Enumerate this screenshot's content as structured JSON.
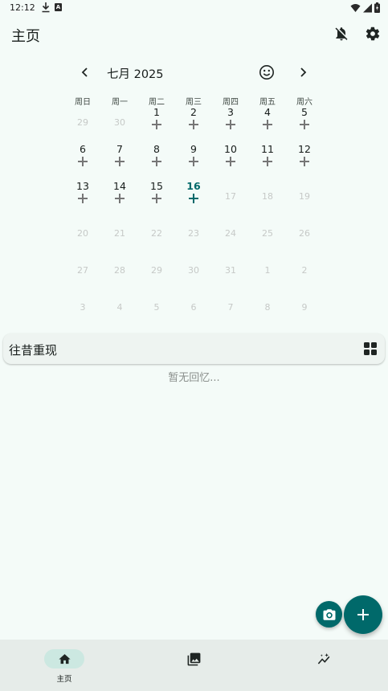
{
  "status_bar": {
    "time": "12:12",
    "notification_icons": [
      "download-icon",
      "a-badge-icon"
    ],
    "system_icons": [
      "wifi-icon",
      "signal-icon",
      "battery-icon"
    ]
  },
  "app_bar": {
    "title": "主页",
    "icons": [
      "notifications-off-icon",
      "settings-icon"
    ]
  },
  "calendar": {
    "month_label": "七月 2025",
    "weekdays": [
      "周日",
      "周一",
      "周二",
      "周三",
      "周四",
      "周五",
      "周六"
    ],
    "weeks": [
      [
        {
          "d": "29",
          "s": "faded"
        },
        {
          "d": "30",
          "s": "faded"
        },
        {
          "d": "1",
          "s": "add"
        },
        {
          "d": "2",
          "s": "add"
        },
        {
          "d": "3",
          "s": "add"
        },
        {
          "d": "4",
          "s": "add"
        },
        {
          "d": "5",
          "s": "add"
        }
      ],
      [
        {
          "d": "6",
          "s": "add"
        },
        {
          "d": "7",
          "s": "add"
        },
        {
          "d": "8",
          "s": "add"
        },
        {
          "d": "9",
          "s": "add"
        },
        {
          "d": "10",
          "s": "add"
        },
        {
          "d": "11",
          "s": "add"
        },
        {
          "d": "12",
          "s": "add"
        }
      ],
      [
        {
          "d": "13",
          "s": "add"
        },
        {
          "d": "14",
          "s": "add"
        },
        {
          "d": "15",
          "s": "add"
        },
        {
          "d": "16",
          "s": "today"
        },
        {
          "d": "17",
          "s": "faded"
        },
        {
          "d": "18",
          "s": "faded"
        },
        {
          "d": "19",
          "s": "faded"
        }
      ],
      [
        {
          "d": "20",
          "s": "faded"
        },
        {
          "d": "21",
          "s": "faded"
        },
        {
          "d": "22",
          "s": "faded"
        },
        {
          "d": "23",
          "s": "faded"
        },
        {
          "d": "24",
          "s": "faded"
        },
        {
          "d": "25",
          "s": "faded"
        },
        {
          "d": "26",
          "s": "faded"
        }
      ],
      [
        {
          "d": "27",
          "s": "faded"
        },
        {
          "d": "28",
          "s": "faded"
        },
        {
          "d": "29",
          "s": "faded"
        },
        {
          "d": "30",
          "s": "faded"
        },
        {
          "d": "31",
          "s": "faded"
        },
        {
          "d": "1",
          "s": "faded"
        },
        {
          "d": "2",
          "s": "faded"
        }
      ],
      [
        {
          "d": "3",
          "s": "faded"
        },
        {
          "d": "4",
          "s": "faded"
        },
        {
          "d": "5",
          "s": "faded"
        },
        {
          "d": "6",
          "s": "faded"
        },
        {
          "d": "7",
          "s": "faded"
        },
        {
          "d": "8",
          "s": "faded"
        },
        {
          "d": "9",
          "s": "faded"
        }
      ]
    ]
  },
  "memories": {
    "title": "往昔重现",
    "empty_text": "暂无回忆..."
  },
  "bottom_nav": {
    "items": [
      {
        "label": "主页",
        "icon": "home-icon",
        "active": true
      },
      {
        "label": "",
        "icon": "photo-library-icon"
      },
      {
        "label": "",
        "icon": "insights-icon"
      }
    ]
  },
  "colors": {
    "accent": "#00696a",
    "background": "#f4fbf8",
    "nav_background": "#e6ece9",
    "active_pill": "#cce8e1"
  }
}
